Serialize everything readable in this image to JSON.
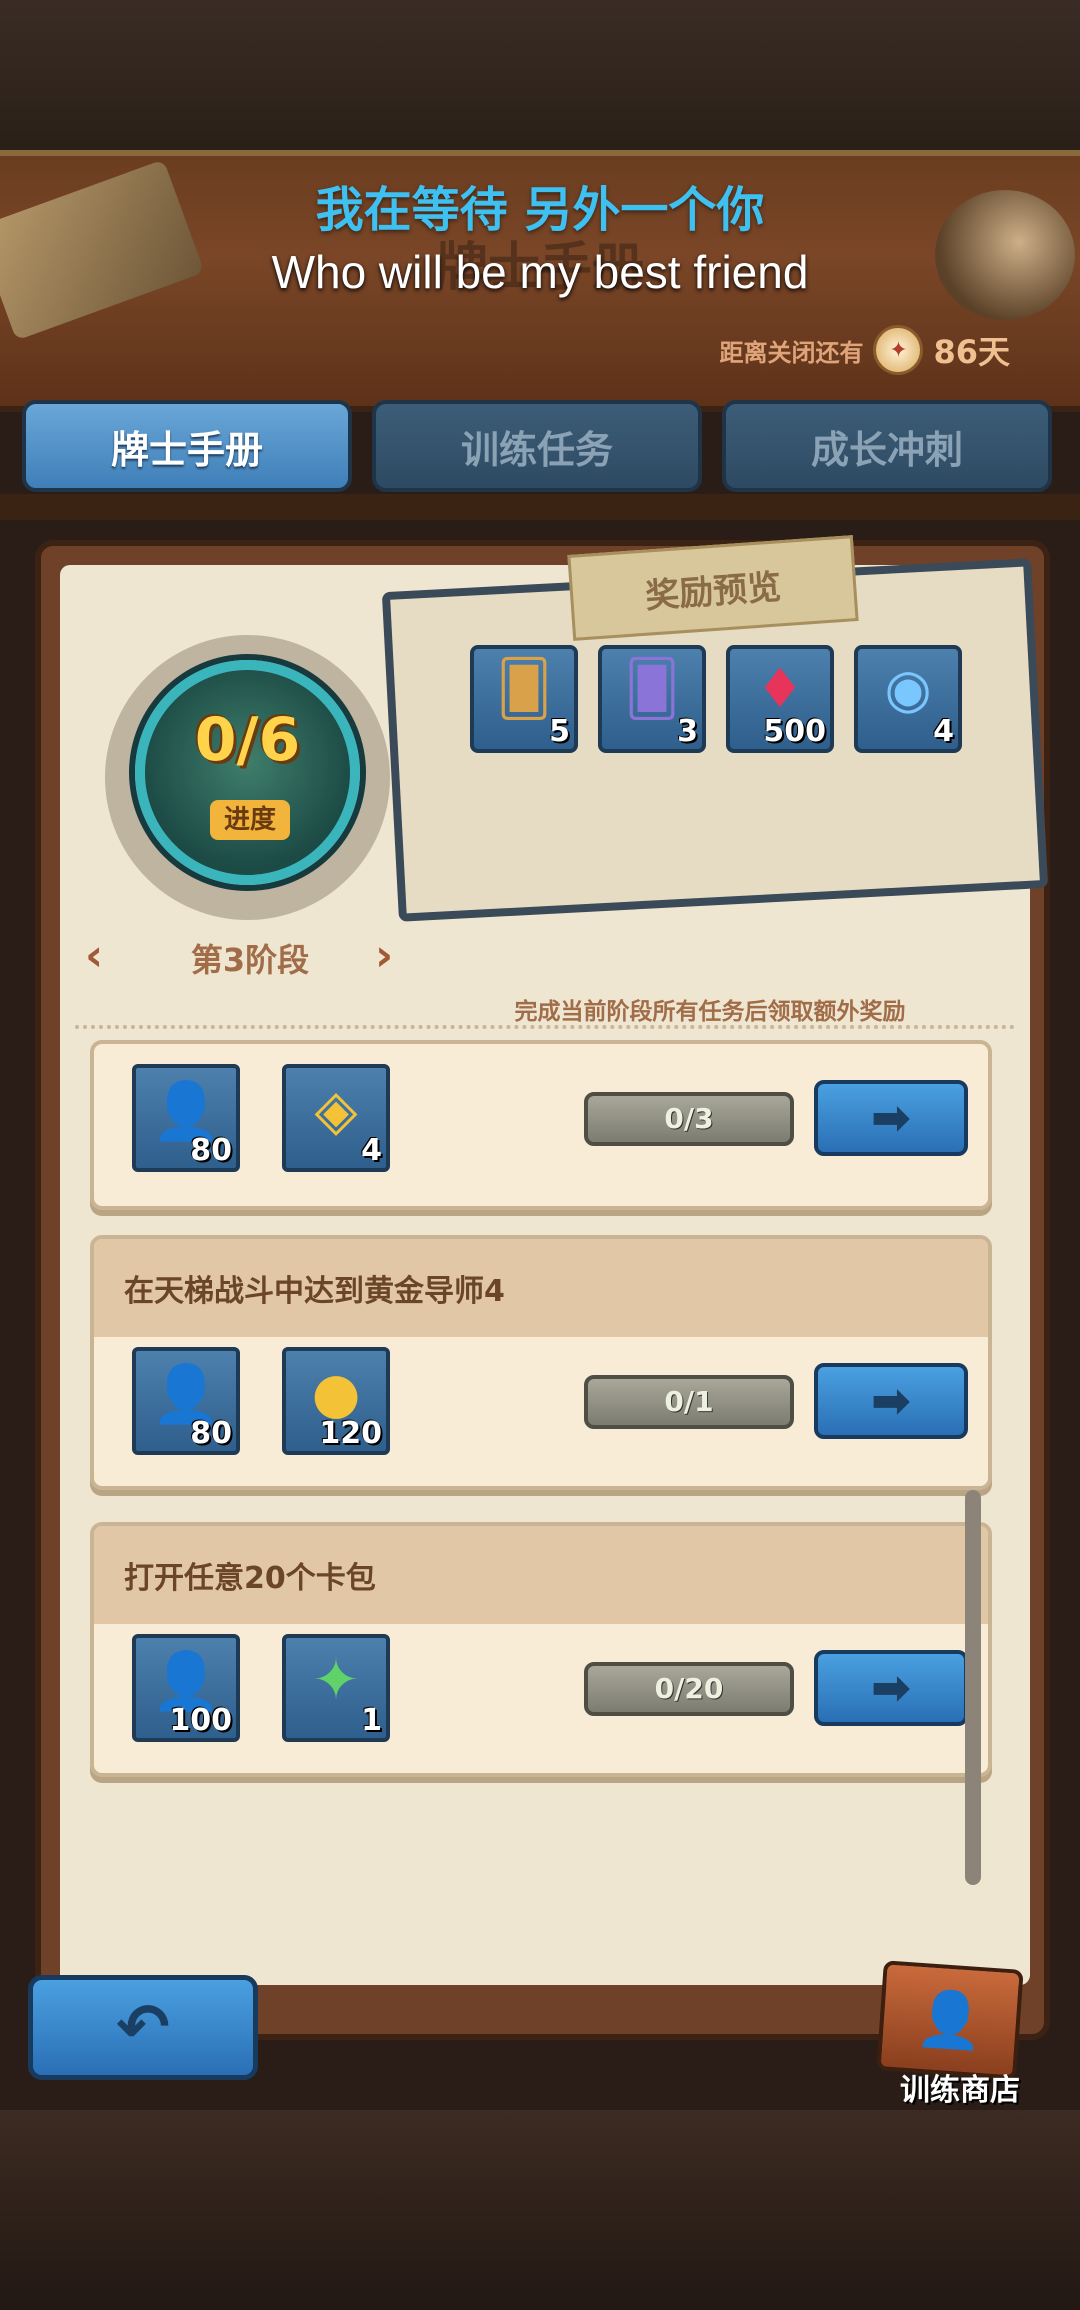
{
  "overlay": {
    "subtitle_cn": "我在等待 另外一个你",
    "subtitle_en": "Who will be my best friend"
  },
  "header": {
    "title": "牌士手册",
    "countdown_label": "距离关闭还有",
    "countdown_value": "86天"
  },
  "tabs": [
    {
      "label": "牌士手册",
      "active": true
    },
    {
      "label": "训练任务",
      "active": false
    },
    {
      "label": "成长冲刺",
      "active": false
    }
  ],
  "progress_badge": {
    "value": "0/6",
    "label": "进度"
  },
  "stage": {
    "label": "第3阶段",
    "prev_glyph": "‹",
    "next_glyph": "›"
  },
  "reward_preview": {
    "title": "奖励预览",
    "caption": "完成当前阶段所有任务后领取额外奖励",
    "items": [
      {
        "icon": "card-pack-bronze-icon",
        "glyph": "🂠",
        "count": "5"
      },
      {
        "icon": "card-pack-purple-icon",
        "glyph": "🂠",
        "count": "3"
      },
      {
        "icon": "ruby-gem-icon",
        "glyph": "♦",
        "count": "500"
      },
      {
        "icon": "rainbow-orb-icon",
        "glyph": "◉",
        "count": "4"
      }
    ]
  },
  "tasks": [
    {
      "title": "",
      "rewards": [
        {
          "icon": "trainer-xp-icon",
          "glyph": "👤",
          "count": "80"
        },
        {
          "icon": "gold-crystal-coin-icon",
          "glyph": "◈",
          "count": "4"
        }
      ],
      "progress": "0/3",
      "go_glyph": "➡"
    },
    {
      "title": "在天梯战斗中达到黄金导师4",
      "rewards": [
        {
          "icon": "trainer-xp-icon",
          "glyph": "👤",
          "count": "80"
        },
        {
          "icon": "gold-coin-icon",
          "glyph": "●",
          "count": "120"
        }
      ],
      "progress": "0/1",
      "go_glyph": "➡"
    },
    {
      "title": "打开任意20个卡包",
      "rewards": [
        {
          "icon": "trainer-xp-icon",
          "glyph": "👤",
          "count": "100"
        },
        {
          "icon": "green-crystal-icon",
          "glyph": "✦",
          "count": "1"
        }
      ],
      "progress": "0/20",
      "go_glyph": "➡"
    }
  ],
  "bottom": {
    "back_glyph": "↶",
    "shop_label": "训练商店",
    "shop_glyph": "👤"
  },
  "colors": {
    "accent_blue": "#3f7fb8",
    "subtitle_cyan": "#3ec0f0",
    "panel_brown": "#6f4128",
    "badge_gold": "#ffd34a"
  }
}
